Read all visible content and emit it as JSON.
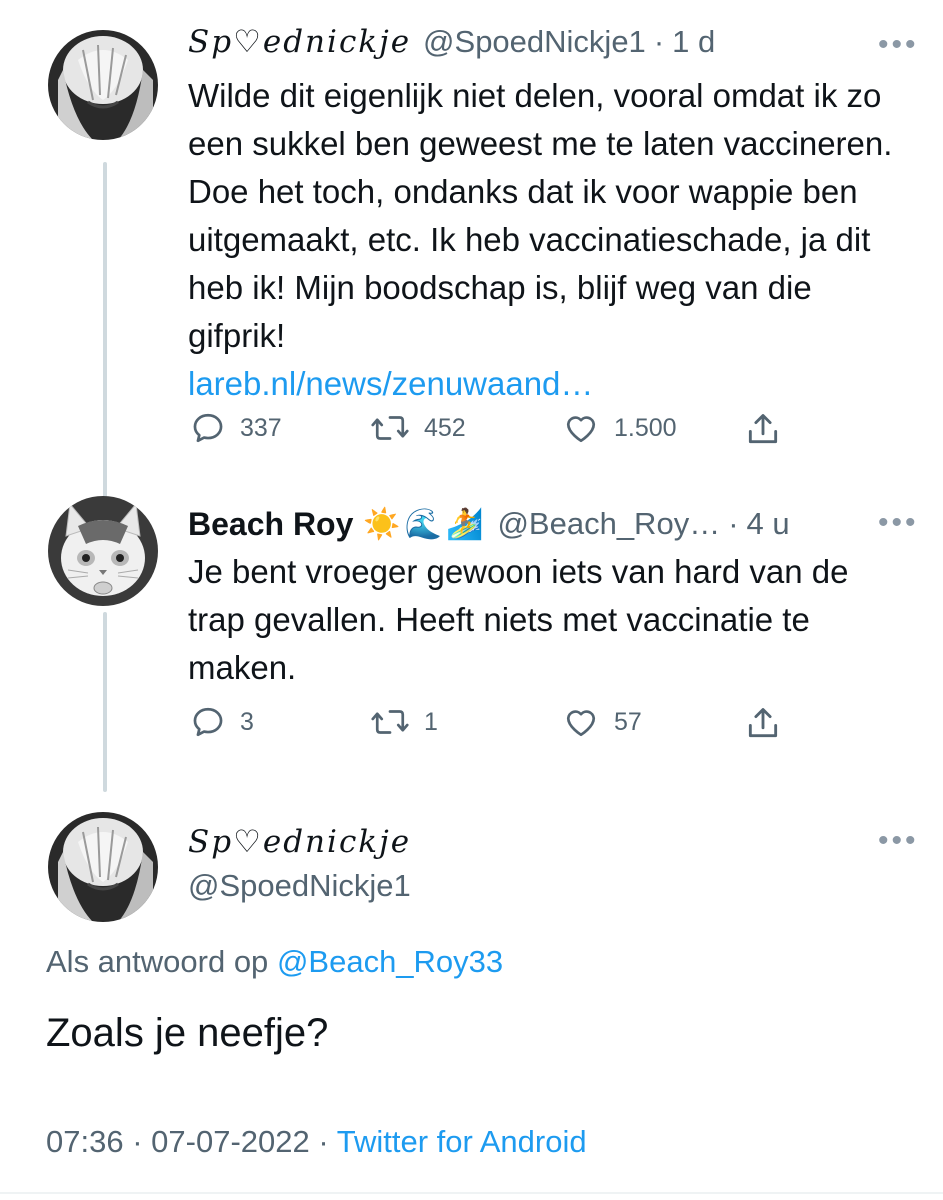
{
  "tweet1": {
    "display_name": "Sp♡ednickje",
    "handle": "@SpoedNickje1",
    "separator": "·",
    "time": "1 d",
    "text": "Wilde dit eigenlijk niet delen, vooral omdat ik zo een sukkel ben geweest me te laten vaccineren. Doe het toch, ondanks dat ik voor wappie ben uitgemaakt, etc. Ik heb vaccinatieschade, ja dit heb ik! Mijn boodschap is, blijf weg van die gifprik!",
    "link": "lareb.nl/news/zenuwaand…",
    "replies": "337",
    "retweets": "452",
    "likes": "1.500"
  },
  "tweet2": {
    "display_name": "Beach Roy",
    "emojis": "☀️🌊🏄",
    "handle": "@Beach_Roy…",
    "separator": "·",
    "time": "4 u",
    "text": "Je bent vroeger gewoon iets van hard van de trap gevallen. Heeft niets met vaccinatie te maken.",
    "replies": "3",
    "retweets": "1",
    "likes": "57"
  },
  "tweet3": {
    "display_name": "Sp♡ednickje",
    "handle": "@SpoedNickje1",
    "reply_prefix": "Als antwoord op",
    "reply_to": "@Beach_Roy33",
    "text": "Zoals je neefje?",
    "time": "07:36",
    "separator": "·",
    "date": "07-07-2022",
    "client": "Twitter for Android"
  },
  "icons": {
    "more": "more-horizontal-icon",
    "reply": "reply-bubble-icon",
    "retweet": "retweet-icon",
    "like": "heart-icon",
    "share": "share-icon"
  },
  "colors": {
    "link": "#1d9bf0",
    "secondary_text": "#536471",
    "thread_line": "#cfd9de"
  }
}
